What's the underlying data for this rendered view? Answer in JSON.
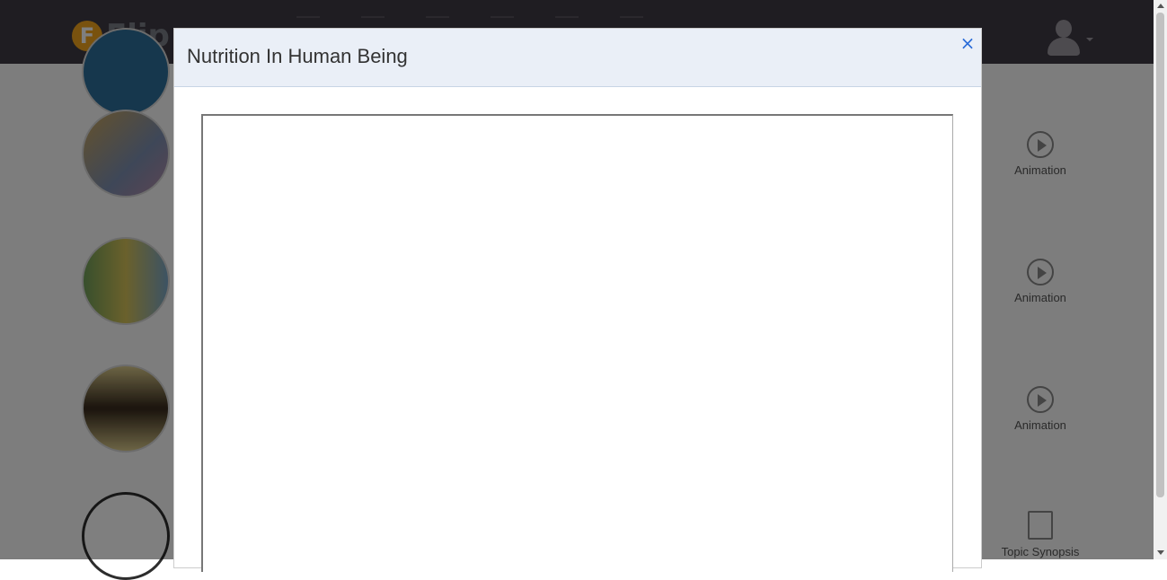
{
  "app": {
    "logo_text": "Flip",
    "logo_letter": "F"
  },
  "header": {
    "nav_icons": [
      "home-icon",
      "profile-icon",
      "book-icon",
      "mail-icon",
      "chart-icon",
      "chat-icon"
    ]
  },
  "side_items": [
    {
      "label": "Animation",
      "icon": "play-circle-icon"
    },
    {
      "label": "Animation",
      "icon": "play-circle-icon"
    },
    {
      "label": "Animation",
      "icon": "play-circle-icon"
    },
    {
      "label": "Topic Synopsis",
      "icon": "document-icon"
    }
  ],
  "modal": {
    "title": "Nutrition In Human Being",
    "close_label": "×"
  },
  "colors": {
    "topbar": "#3f3a44",
    "modal_header": "#eaeff7",
    "close_icon": "#2a6cd8",
    "logo_accent": "#f2a51c"
  }
}
